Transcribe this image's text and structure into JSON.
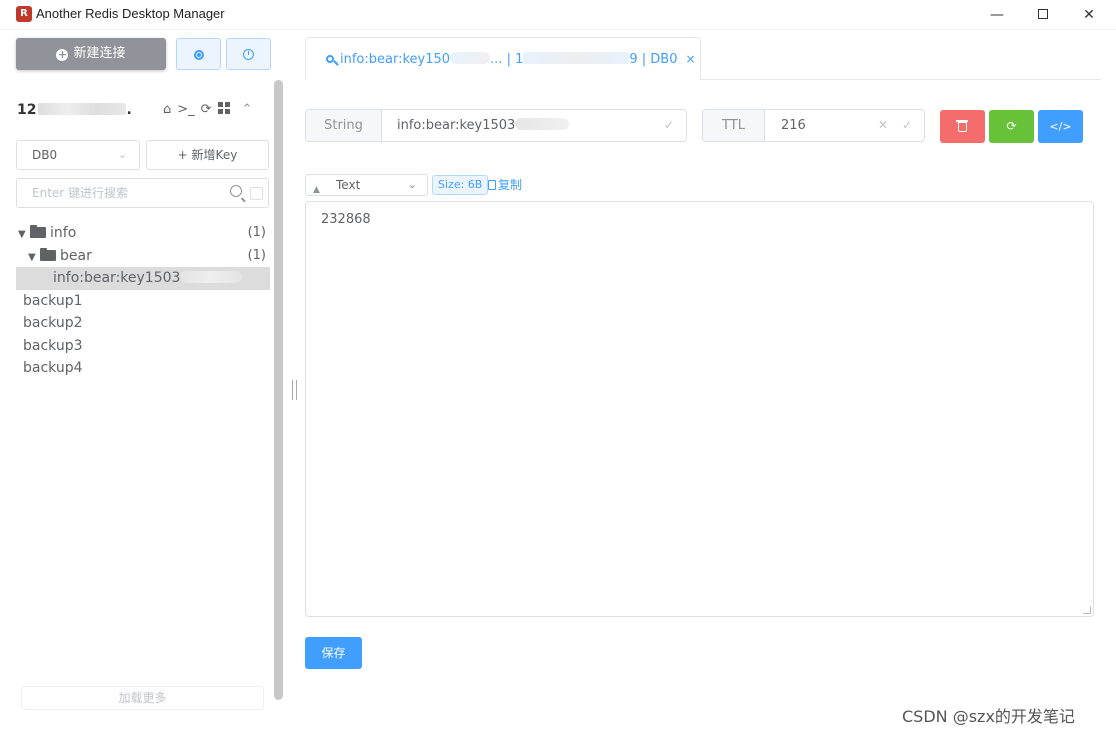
{
  "window": {
    "title": "Another Redis Desktop Manager",
    "minimize": "—",
    "close": "✕"
  },
  "sidebar": {
    "new_connection_label": "新建连接",
    "connection_name_prefix": "12",
    "connection_name_suffix": ".",
    "db_select": "DB0",
    "new_key_label": "+ 新增Key",
    "search_placeholder": "Enter 键进行搜索",
    "tree": [
      {
        "label": "info",
        "count": "(1)"
      },
      {
        "label": "bear",
        "count": "(1)"
      },
      {
        "label": "info:bear:key1503"
      },
      {
        "label": "backup1"
      },
      {
        "label": "backup2"
      },
      {
        "label": "backup3"
      },
      {
        "label": "backup4"
      }
    ],
    "load_more_label": "加载更多"
  },
  "tab": {
    "title_start": "info:bear:key150",
    "title_mid": "... | 1",
    "title_end": "9 | DB0",
    "close": "×"
  },
  "key_info": {
    "type_label": "String",
    "key_name": "info:bear:key1503",
    "ttl_label": "TTL",
    "ttl_value": "216"
  },
  "actions": {
    "code_label": "</>"
  },
  "viewer": {
    "format": "Text",
    "size": "Size: 6B",
    "copy_label": "复制",
    "content": "232868",
    "save_label": "保存"
  },
  "watermark": "CSDN @szx的开发笔记",
  "colors": {
    "primary": "#409eff",
    "danger": "#f56c6c",
    "success": "#67c23a",
    "info": "#909399"
  }
}
